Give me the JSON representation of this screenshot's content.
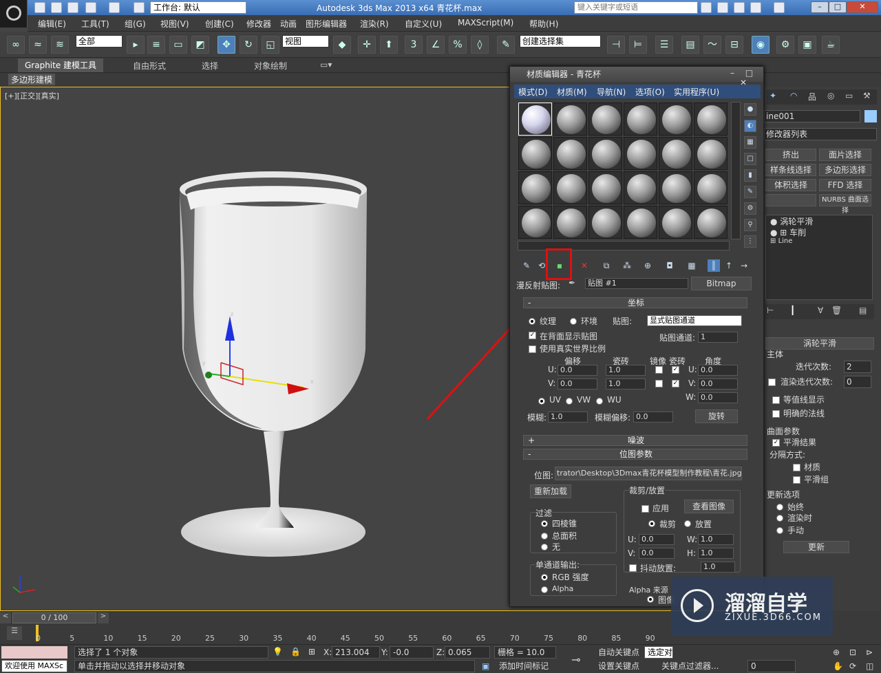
{
  "titlebar": {
    "title": "Autodesk 3ds Max  2013 x64      青花杯.max",
    "workspace": "工作台: 默认",
    "search_placeholder": "键入关键字或短语"
  },
  "menu": [
    "编辑(E)",
    "工具(T)",
    "组(G)",
    "视图(V)",
    "创建(C)",
    "修改器",
    "动画",
    "图形编辑器",
    "渲染(R)",
    "自定义(U)",
    "MAXScript(M)",
    "帮助(H)"
  ],
  "toolbar": {
    "selection_filter": "全部",
    "ref_coord": "视图",
    "named_selection": "创建选择集"
  },
  "ribbon": {
    "tabs": [
      "Graphite 建模工具",
      "自由形式",
      "选择",
      "对象绘制"
    ],
    "sub": "多边形建模"
  },
  "viewport": {
    "label": "[+][正交][真实]"
  },
  "material_editor": {
    "title": "材质编辑器 - 青花杯",
    "menu": [
      "模式(D)",
      "材质(M)",
      "导航(N)",
      "选项(O)",
      "实用程序(U)"
    ],
    "map_label": "漫反射贴图:",
    "map_name": "贴图 #1",
    "map_type": "Bitmap",
    "coord_rollout": "坐标",
    "texture": "纹理",
    "environ": "环境",
    "mapping_label": "贴图:",
    "mapping_value": "显式贴图通道",
    "show_back": "在背面显示贴图",
    "channel_label": "贴图通道:",
    "channel_value": "1",
    "real_world": "使用真实世界比例",
    "col_offset": "偏移",
    "col_tiling": "瓷砖",
    "col_mirror": "镜像",
    "col_tile": "瓷砖",
    "col_angle": "角度",
    "u_label": "U:",
    "v_label": "V:",
    "w_label": "W:",
    "u_offset": "0.0",
    "v_offset": "0.0",
    "u_tiling": "1.0",
    "v_tiling": "1.0",
    "u_angle": "0.0",
    "v_angle": "0.0",
    "w_angle": "0.0",
    "uv": "UV",
    "vw": "VW",
    "wu": "WU",
    "blur_label": "模糊:",
    "blur_value": "1.0",
    "blur_offset_label": "模糊偏移:",
    "blur_offset_value": "0.0",
    "rotate": "旋转",
    "noise_rollout": "噪波",
    "bitmap_rollout": "位图参数",
    "bitmap_label": "位图:",
    "bitmap_path": "trator\\Desktop\\3Dmax青花杯模型制作教程\\青花.jpg",
    "reload": "重新加载",
    "crop_group": "裁剪/放置",
    "apply": "应用",
    "view_image": "查看图像",
    "crop": "裁剪",
    "place": "放置",
    "filter_group": "过滤",
    "pyramidal": "四棱锥",
    "summed": "总面积",
    "none": "无",
    "mono_group": "单通道输出:",
    "rgb": "RGB 强度",
    "alpha": "Alpha",
    "crop_u": "0.0",
    "crop_v": "0.0",
    "crop_w": "1.0",
    "crop_h": "1.0",
    "h_label": "H:",
    "jitter": "抖动放置:",
    "jitter_value": "1.0",
    "alpha_source": "Alpha 来源",
    "image_alpha": "图像"
  },
  "command_panel": {
    "object_name": "ine001",
    "modifier_list": "修改器列表",
    "buttons": [
      "挤出",
      "面片选择",
      "样条线选择",
      "多边形选择",
      "体积选择",
      "FFD 选择",
      "",
      "NURBS 曲面选择"
    ],
    "stack": [
      "涡轮平滑",
      "车削",
      "Line"
    ],
    "rollout": "涡轮平滑",
    "main": "主体",
    "iterations_label": "迭代次数:",
    "iterations": "2",
    "render_iters_label": "渲染迭代次数:",
    "render_iters": "0",
    "isoline": "等值线显示",
    "explicit_normals": "明确的法线",
    "surface_params": "曲面参数",
    "smooth_result": "平滑结果",
    "separate_by": "分隔方式:",
    "materials": "材质",
    "smoothing_groups": "平滑组",
    "update_options": "更新选项",
    "always": "始终",
    "when_rendering": "渲染时",
    "manually": "手动",
    "update": "更新"
  },
  "timeline": {
    "frame": "0 / 100",
    "ticks": [
      "0",
      "5",
      "10",
      "15",
      "20",
      "25",
      "30",
      "35",
      "40",
      "45",
      "50",
      "55",
      "60",
      "65",
      "70",
      "75",
      "80",
      "85",
      "90"
    ]
  },
  "status": {
    "selected": "选择了 1 个对象",
    "hint": "单击并拖动以选择并移动对象",
    "welcome": "欢迎使用 MAXSc",
    "x": "213.004",
    "y": "-0.0",
    "z": "0.065",
    "grid": "栅格 = 10.0",
    "auto_key": "自动关键点",
    "set_key": "设置关键点",
    "selected_obj": "选定对",
    "key_filter": "关键点过滤器...",
    "add_tag": "添加时间标记",
    "frame": "0"
  },
  "watermark": {
    "title": "溜溜自学",
    "subtitle": "ZIXUE.3D66.COM"
  },
  "gizmo": {
    "x": "x",
    "y": "y",
    "z": "z"
  }
}
